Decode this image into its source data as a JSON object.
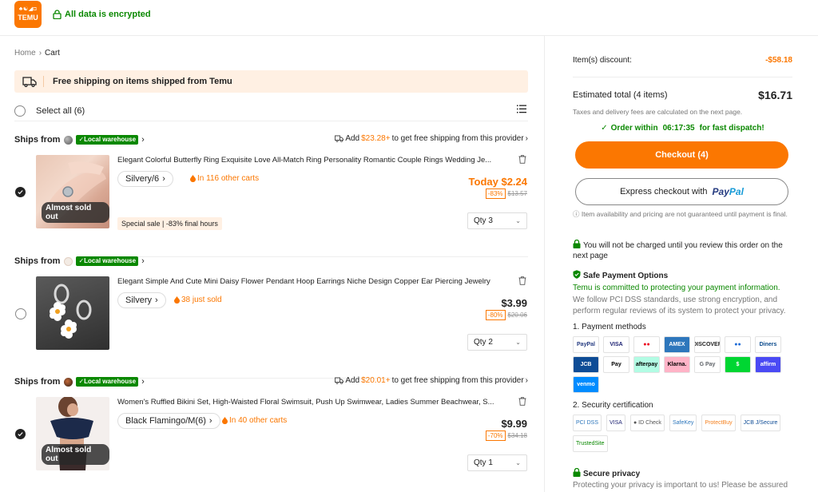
{
  "header": {
    "logo_glyphs": "♣☯◢◘",
    "logo_text": "TEMU",
    "encrypted": "All data is encrypted"
  },
  "breadcrumb": {
    "home": "Home",
    "separator": "›",
    "current": "Cart"
  },
  "banner": {
    "text": "Free shipping on items shipped from Temu"
  },
  "select_all": {
    "label": "Select all (6)"
  },
  "sections": [
    {
      "ships_from": "Ships from",
      "badge": "✓Local warehouse",
      "seller_color": "#777777",
      "add_prefix": "Add",
      "add_amount": "$23.28+",
      "add_suffix": "to get free shipping from this provider",
      "item": {
        "title": "Elegant Colorful Butterfly Ring Exquisite Love All-Match Ring Personality Romantic Couple Rings Wedding Je...",
        "variant": "Silvery/6",
        "hot": "In 116 other carts",
        "price": "Today $2.24",
        "discount": "-83%",
        "old_price": "$13.57",
        "qty": "Qty 3",
        "selected": true,
        "sold_out_badge": "Almost sold out",
        "special": "Special sale | -83% final hours"
      }
    },
    {
      "ships_from": "Ships from",
      "badge": "✓Local warehouse",
      "seller_color": "#e8d8cc",
      "item": {
        "title": "Elegant Simple And Cute Mini Daisy Flower Pendant Hoop Earrings Niche Design Copper Ear Piercing Jewelry",
        "variant": "Silvery",
        "hot": "38 just sold",
        "price": "$3.99",
        "discount": "-80%",
        "old_price": "$20.06",
        "qty": "Qty 2",
        "selected": false
      }
    },
    {
      "ships_from": "Ships from",
      "badge": "✓Local warehouse",
      "seller_color": "#5a3a2a",
      "add_prefix": "Add",
      "add_amount": "$20.01+",
      "add_suffix": "to get free shipping from this provider",
      "item": {
        "title": "Women's Ruffled Bikini Set, High-Waisted Floral Swimsuit, Push Up Swimwear, Ladies Summer Beachwear, S...",
        "variant": "Black Flamingo/M(6)",
        "hot": "In 40 other carts",
        "price": "$9.99",
        "discount": "-70%",
        "old_price": "$34.18",
        "qty": "Qty 1",
        "selected": true,
        "sold_out_badge": "Almost sold out"
      }
    }
  ],
  "summary": {
    "discount_label": "Item(s) discount:",
    "discount_value": "-$58.18",
    "total_label": "Estimated total (4 items)",
    "total_value": "$16.71",
    "taxes_note": "Taxes and delivery fees are calculated on the next page.",
    "dispatch_prefix": "Order within",
    "dispatch_time": "06:17:35",
    "dispatch_suffix": "for fast dispatch!",
    "checkout_label": "Checkout (4)",
    "express_label": "Express checkout with",
    "paypal_part1": "Pay",
    "paypal_part2": "Pal",
    "availability": "ⓘ Item availability and pricing are not guaranteed until payment is final.",
    "not_charged": "You will not be charged until you review this order on the next page",
    "safe_title": "Safe Payment Options",
    "safe_green": "Temu is committed to protecting your payment information.",
    "safe_gray": "We follow PCI DSS standards, use strong encryption, and perform regular reviews of its system to protect your privacy.",
    "payment_methods_title": "1. Payment methods",
    "payment_methods": [
      {
        "name": "PayPal",
        "color": "#253b80",
        "bg": "#ffffff"
      },
      {
        "name": "VISA",
        "color": "#1a1f71",
        "bg": "#ffffff"
      },
      {
        "name": "●●",
        "color": "#eb001b",
        "bg": "#ffffff"
      },
      {
        "name": "AMEX",
        "color": "#ffffff",
        "bg": "#2e77bc"
      },
      {
        "name": "DISCOVER",
        "color": "#222222",
        "bg": "#ffffff"
      },
      {
        "name": "●●",
        "color": "#1b6ad6",
        "bg": "#ffffff"
      },
      {
        "name": "Diners",
        "color": "#0a4a8c",
        "bg": "#ffffff"
      },
      {
        "name": "JCB",
        "color": "#ffffff",
        "bg": "#0e4c96"
      },
      {
        "name": " Pay",
        "color": "#000000",
        "bg": "#ffffff"
      },
      {
        "name": "afterpay",
        "color": "#000000",
        "bg": "#b2fce4"
      },
      {
        "name": "Klarna.",
        "color": "#000000",
        "bg": "#ffb3c7"
      },
      {
        "name": "G Pay",
        "color": "#5f6368",
        "bg": "#ffffff"
      },
      {
        "name": "$",
        "color": "#ffffff",
        "bg": "#00d632"
      },
      {
        "name": "affirm",
        "color": "#ffffff",
        "bg": "#4a4af4"
      },
      {
        "name": "venmo",
        "color": "#ffffff",
        "bg": "#008cff"
      }
    ],
    "security_title": "2. Security certification",
    "certifications": [
      {
        "name": "PCI DSS",
        "color": "#2e77bc"
      },
      {
        "name": "VISA",
        "color": "#1a1f71"
      },
      {
        "name": "● ID Check",
        "color": "#555555"
      },
      {
        "name": "SafeKey",
        "color": "#2e77bc"
      },
      {
        "name": "ProtectBuy",
        "color": "#f58220"
      },
      {
        "name": "JCB J/Secure",
        "color": "#0e4c96"
      },
      {
        "name": "TrustedSite",
        "color": "#0a8800"
      }
    ],
    "privacy_title": "Secure privacy",
    "privacy_text": "Protecting your privacy is important to us! Please be assured"
  },
  "colors": {
    "brand": "#fb7701",
    "green": "#0a8800"
  }
}
